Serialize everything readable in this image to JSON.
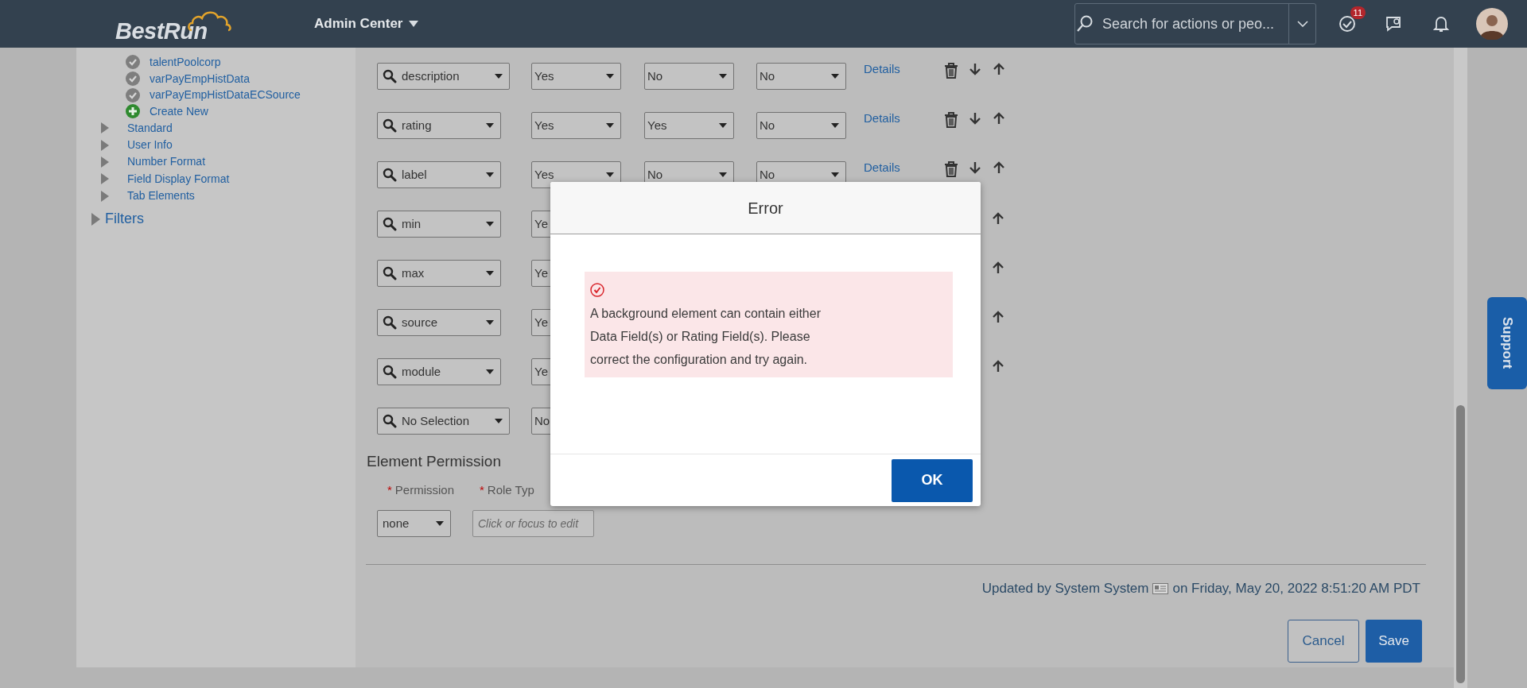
{
  "header": {
    "logo": "BestRun",
    "menu": "Admin Center",
    "search": {
      "placeholder": "Search for actions or peo..."
    },
    "notifications": "11"
  },
  "sidebar": {
    "items": [
      {
        "kind": "check",
        "label": "talentPoolcorp"
      },
      {
        "kind": "check",
        "label": "varPayEmpHistData"
      },
      {
        "kind": "check",
        "label": "varPayEmpHistDataECSource"
      },
      {
        "kind": "add",
        "label": "Create New"
      },
      {
        "kind": "node",
        "label": "Standard",
        "expanded": false
      },
      {
        "kind": "node",
        "label": "User Info",
        "expanded": false
      },
      {
        "kind": "node",
        "label": "Number Format",
        "expanded": false
      },
      {
        "kind": "node",
        "label": "Field Display Format",
        "expanded": false
      },
      {
        "kind": "node",
        "label": "Tab Elements",
        "expanded": false
      }
    ],
    "sections": [
      {
        "label": "Filters",
        "expanded": false
      }
    ]
  },
  "fields": [
    {
      "field": "description",
      "values": [
        "Yes",
        "No",
        "No"
      ],
      "link": "Details",
      "tools": [
        {
          "kind": "delete"
        },
        {
          "kind": "down"
        },
        {
          "kind": "up"
        }
      ]
    },
    {
      "field": "rating",
      "values": [
        "Yes",
        "Yes",
        "No"
      ],
      "link": "Details",
      "tools": [
        {
          "kind": "delete"
        },
        {
          "kind": "down"
        },
        {
          "kind": "up"
        }
      ]
    },
    {
      "field": "label",
      "values": [
        "Yes",
        "No",
        "No"
      ],
      "link": "Details",
      "tools": [
        {
          "kind": "delete"
        },
        {
          "kind": "down"
        },
        {
          "kind": "up"
        }
      ]
    },
    {
      "field": "min",
      "values": [
        "Ye"
      ],
      "tools": [
        {
          "kind": "up"
        }
      ]
    },
    {
      "field": "max",
      "values": [
        "Ye"
      ],
      "tools": [
        {
          "kind": "up"
        }
      ]
    },
    {
      "field": "source",
      "values": [
        "Ye"
      ],
      "tools": [
        {
          "kind": "up"
        }
      ]
    },
    {
      "field": "module",
      "values": [
        "Ye"
      ],
      "tools": [
        {
          "kind": "up"
        }
      ]
    },
    {
      "field": "No Selection",
      "values": [
        "No"
      ]
    }
  ],
  "permission": {
    "title": "Element Permission",
    "labels": [
      {
        "mark": "*",
        "text": "Permission"
      },
      {
        "mark": "*",
        "text": "Role Typ"
      }
    ],
    "select": "none",
    "input": {
      "placeholder": "Click or focus to edit"
    }
  },
  "footer": {
    "updated_before": "Updated by System System",
    "updated_after": "on Friday, May 20, 2022 8:51:20 AM PDT",
    "buttons": [
      {
        "label": "Cancel",
        "kind": "secondary"
      },
      {
        "label": "Save",
        "kind": "primary"
      }
    ]
  },
  "support": "Support",
  "dialog": {
    "title": "Error",
    "message_lines": [
      "A background element can contain either",
      "Data Field(s) or Rating Field(s). Please",
      "correct the configuration and try again."
    ],
    "button": "OK"
  }
}
